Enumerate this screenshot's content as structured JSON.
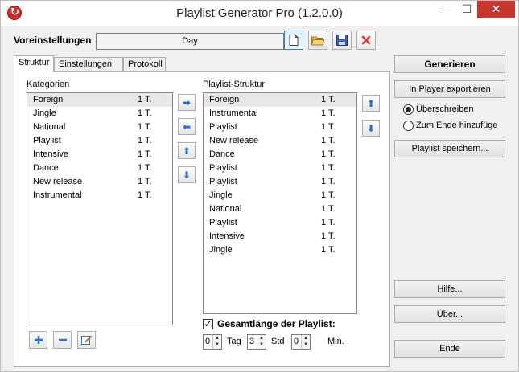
{
  "window": {
    "title": "Playlist Generator Pro (1.2.0.0)",
    "icons": {
      "app": "refresh-circle-icon",
      "minimize": "minimize-icon",
      "maximize": "maximize-icon",
      "close": "close-icon"
    },
    "controls": {
      "minimize": "—",
      "maximize": "☐",
      "close": "✕"
    }
  },
  "presets": {
    "label": "Voreinstellungen",
    "value": "Day",
    "buttons": [
      "new-file-icon",
      "open-folder-icon",
      "save-disk-icon",
      "delete-x-icon"
    ]
  },
  "tabs": [
    {
      "label": "Struktur",
      "active": true
    },
    {
      "label": "Einstellungen",
      "active": false
    },
    {
      "label": "Protokoll",
      "active": false
    }
  ],
  "categories": {
    "label": "Kategorien",
    "items": [
      {
        "name": "Foreign",
        "count": "1 T."
      },
      {
        "name": "Jingle",
        "count": "1 T."
      },
      {
        "name": "National",
        "count": "1 T."
      },
      {
        "name": "Playlist",
        "count": "1 T."
      },
      {
        "name": "Intensive",
        "count": "1 T."
      },
      {
        "name": "Dance",
        "count": "1 T."
      },
      {
        "name": "New release",
        "count": "1 T."
      },
      {
        "name": "Instrumental",
        "count": "1 T."
      }
    ],
    "selected_index": 0
  },
  "structure": {
    "label": "Playlist-Struktur",
    "items": [
      {
        "name": "Foreign",
        "count": "1 T."
      },
      {
        "name": "Instrumental",
        "count": "1 T."
      },
      {
        "name": "Playlist",
        "count": "1 T."
      },
      {
        "name": "New release",
        "count": "1 T."
      },
      {
        "name": "Dance",
        "count": "1 T."
      },
      {
        "name": "Playlist",
        "count": "1 T."
      },
      {
        "name": "Playlist",
        "count": "1 T."
      },
      {
        "name": "Jingle",
        "count": "1 T."
      },
      {
        "name": "National",
        "count": "1 T."
      },
      {
        "name": "Playlist",
        "count": "1 T."
      },
      {
        "name": "Intensive",
        "count": "1 T."
      },
      {
        "name": "Jingle",
        "count": "1 T."
      }
    ],
    "selected_index": 0
  },
  "total_length": {
    "label": "Gesamtlänge der Playlist:",
    "checked": true,
    "days": "0",
    "days_unit": "Tag",
    "hours": "3",
    "hours_unit": "Std",
    "minutes": "0",
    "minutes_unit": "Min."
  },
  "right_panel": {
    "generate": "Generieren",
    "export": "In Player exportieren",
    "radio_overwrite": "Überschreiben",
    "radio_append": "Zum Ende hinzufüge",
    "overwrite_selected": true,
    "save_playlist": "Playlist speichern...",
    "help": "Hilfe...",
    "about": "Über...",
    "end": "Ende"
  },
  "colors": {
    "accent": "#2d6fcc",
    "close_red": "#c7372f",
    "app_icon_red": "#d42b2b"
  }
}
